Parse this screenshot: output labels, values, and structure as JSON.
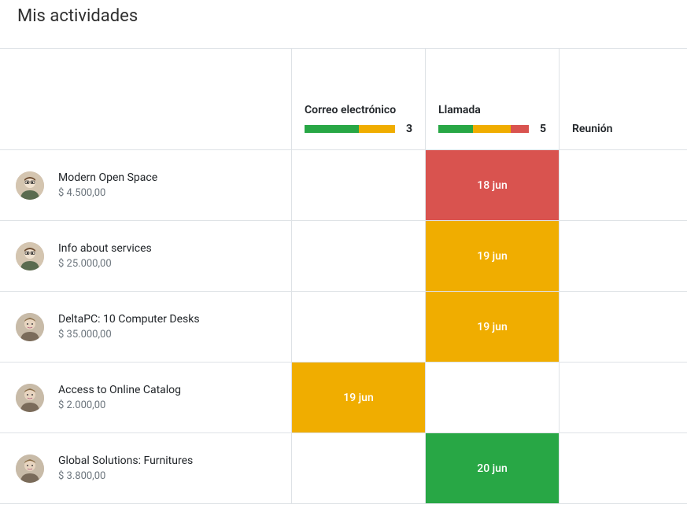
{
  "title": "Mis actividades",
  "columns": [
    {
      "label": "Correo electrónico",
      "count": "3",
      "segments": [
        {
          "color": "green",
          "width": "60%"
        },
        {
          "color": "orange",
          "width": "40%"
        }
      ]
    },
    {
      "label": "Llamada",
      "count": "5",
      "segments": [
        {
          "color": "green",
          "width": "38%"
        },
        {
          "color": "orange",
          "width": "42%"
        },
        {
          "color": "red",
          "width": "20%"
        }
      ]
    },
    {
      "label": "Reunión",
      "count": "",
      "segments": []
    }
  ],
  "rows": [
    {
      "title": "Modern Open Space",
      "amount": "$ 4.500,00",
      "avatar": "user1",
      "cells": [
        {
          "text": "",
          "color": "empty"
        },
        {
          "text": "18 jun",
          "color": "red"
        },
        {
          "text": "",
          "color": "empty"
        }
      ]
    },
    {
      "title": "Info about services",
      "amount": "$ 25.000,00",
      "avatar": "user1",
      "cells": [
        {
          "text": "",
          "color": "empty"
        },
        {
          "text": "19 jun",
          "color": "orange"
        },
        {
          "text": "",
          "color": "empty"
        }
      ]
    },
    {
      "title": "DeltaPC: 10 Computer Desks",
      "amount": "$ 35.000,00",
      "avatar": "user2",
      "cells": [
        {
          "text": "",
          "color": "empty"
        },
        {
          "text": "19 jun",
          "color": "orange"
        },
        {
          "text": "",
          "color": "empty"
        }
      ]
    },
    {
      "title": "Access to Online Catalog",
      "amount": "$ 2.000,00",
      "avatar": "user2",
      "cells": [
        {
          "text": "19 jun",
          "color": "orange"
        },
        {
          "text": "",
          "color": "empty"
        },
        {
          "text": "",
          "color": "empty"
        }
      ]
    },
    {
      "title": "Global Solutions: Furnitures",
      "amount": "$ 3.800,00",
      "avatar": "user2",
      "cells": [
        {
          "text": "",
          "color": "empty"
        },
        {
          "text": "20 jun",
          "color": "green"
        },
        {
          "text": "",
          "color": "empty"
        }
      ]
    }
  ]
}
